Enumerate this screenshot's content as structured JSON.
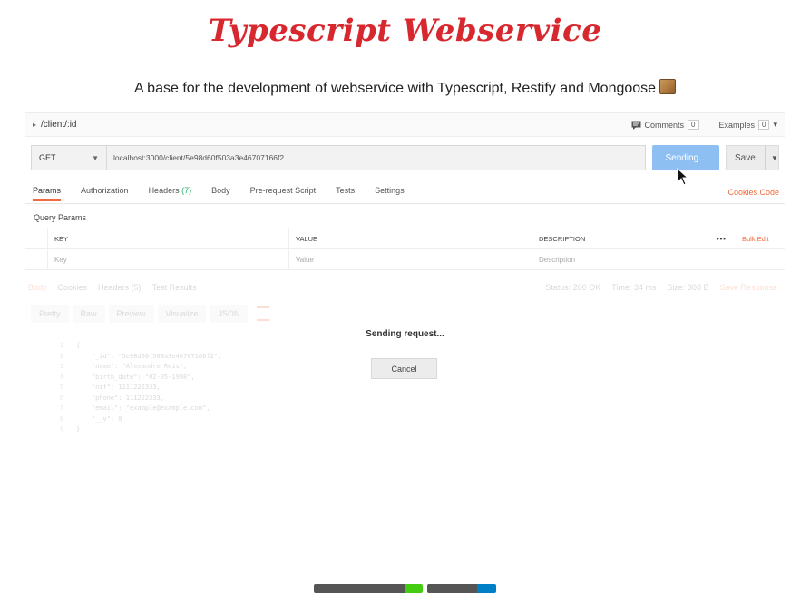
{
  "hero": {
    "title": "Typescript Webservice",
    "subtitle": "A base for the development of webservice with Typescript, Restify and Mongoose",
    "subtitle_emoji": "package-icon"
  },
  "request": {
    "breadcrumb": "/client/:id",
    "comments_label": "Comments",
    "comments_count": "0",
    "examples_label": "Examples",
    "examples_count": "0",
    "method": "GET",
    "url": "localhost:3000/client/5e98d60f503a3e46707166f2",
    "send_label": "Sending...",
    "save_label": "Save",
    "tabs": [
      {
        "label": "Params"
      },
      {
        "label": "Authorization"
      },
      {
        "label": "Headers",
        "count": "(7)"
      },
      {
        "label": "Body"
      },
      {
        "label": "Pre-request Script"
      },
      {
        "label": "Tests"
      },
      {
        "label": "Settings"
      }
    ],
    "right_links": [
      "Cookies",
      "Code"
    ]
  },
  "params": {
    "section_title": "Query Params",
    "headers": {
      "key": "KEY",
      "value": "VALUE",
      "description": "DESCRIPTION",
      "more": "•••",
      "bulk_edit": "Bulk Edit"
    },
    "placeholders": {
      "key": "Key",
      "value": "Value",
      "description": "Description"
    }
  },
  "response": {
    "tabs": [
      "Body",
      "Cookies",
      "Headers (5)",
      "Test Results"
    ],
    "status": "Status: 200 OK",
    "time": "Time: 34 ms",
    "size": "Size: 308 B",
    "save_response": "Save Response",
    "views": [
      "Pretty",
      "Raw",
      "Preview",
      "Visualize"
    ],
    "format": "JSON",
    "code_lines": [
      "{",
      "    \"_id\": \"5e98d60f503a3e46707166f2\",",
      "    \"name\": \"Alexandre Reis\",",
      "    \"birth_date\": \"02-05-1998\",",
      "    \"nif\": 1111222333,",
      "    \"phone\": 111222333,",
      "    \"email\": \"example@example.com\",",
      "    \"__v\": 0",
      "}"
    ]
  },
  "modal": {
    "title": "Sending request...",
    "cancel_label": "Cancel"
  },
  "colors": {
    "brand_red": "#d8282f",
    "accent_orange": "#f26b3a",
    "send_blue": "#8ebff2",
    "badge_green": "#44cc11",
    "badge_blue": "#007ec6"
  }
}
